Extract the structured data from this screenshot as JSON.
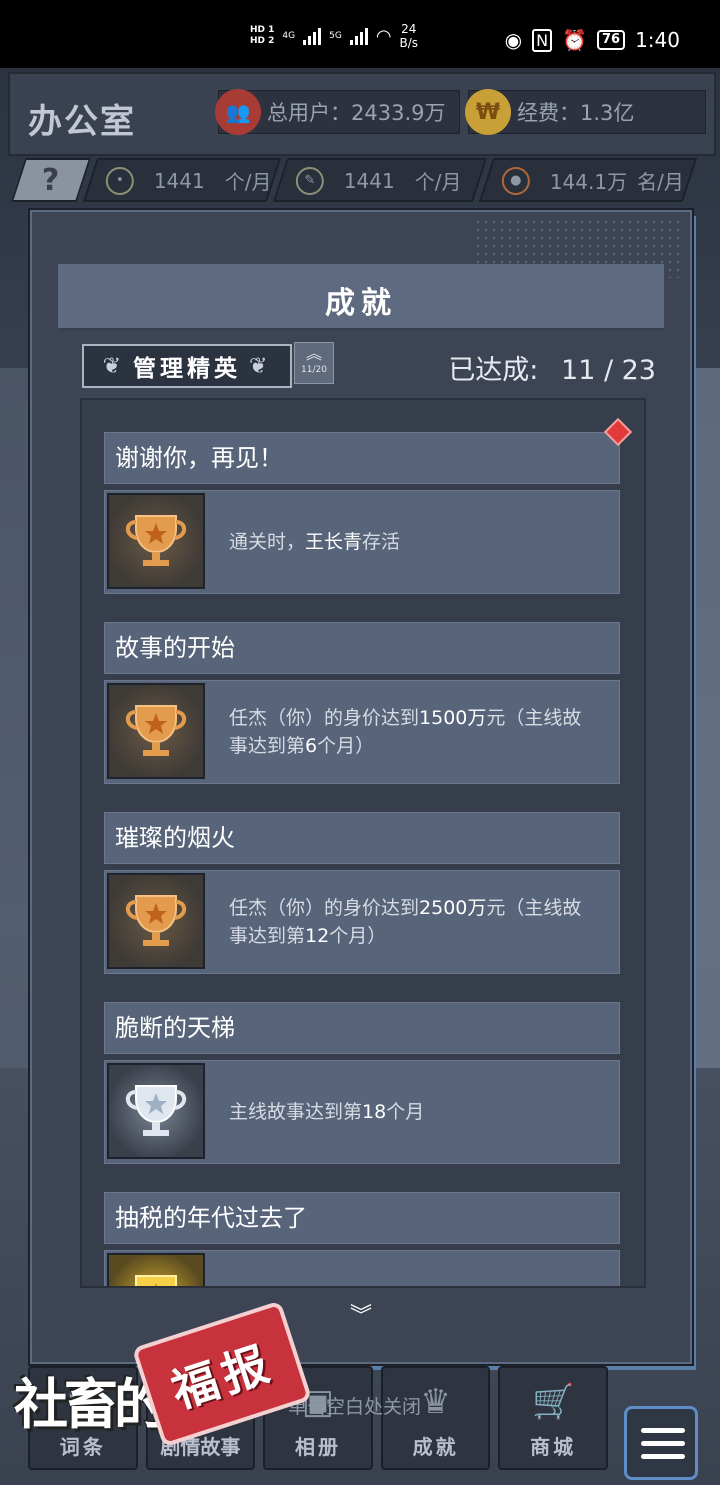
{
  "status_bar": {
    "hd1": "HD 1",
    "hd2": "HD 2",
    "net1": "4G",
    "net2": "5G",
    "speed_value": "24",
    "speed_unit": "B/s",
    "battery": "76",
    "time": "1:40"
  },
  "hud": {
    "office_title": "办公室",
    "users_label": "总用户：2433.9万",
    "fund_label": "经费：1.3亿",
    "help": "?",
    "stat1_value": "1441",
    "stat1_unit": "个/月",
    "stat2_value": "1441",
    "stat2_unit": "个/月",
    "stat3_value": "144.1万",
    "stat3_unit": "名/月"
  },
  "dialog": {
    "title": "成就",
    "rank": "管理精英",
    "rank_progress": "11/20",
    "achieved_label": "已达成:",
    "achieved_value": "11 / 23"
  },
  "achievements": [
    {
      "title": "谢谢你，再见！",
      "desc_pre": "通关时，",
      "desc_highlight": "王长青",
      "desc_post": "存活",
      "trophy": "bronze",
      "new": true
    },
    {
      "title": "故事的开始",
      "desc_pre": "任杰（你）的身价达到",
      "desc_highlight": "1500万",
      "desc_post": "元（主线故事达到第",
      "desc_highlight2": "6",
      "desc_post2": "个月）",
      "trophy": "bronze",
      "new": false
    },
    {
      "title": "璀璨的烟火",
      "desc_pre": "任杰（你）的身价达到",
      "desc_highlight": "2500万",
      "desc_post": "元（主线故事达到第",
      "desc_highlight2": "12",
      "desc_post2": "个月）",
      "trophy": "bronze",
      "new": false
    },
    {
      "title": "脆断的天梯",
      "desc_pre": "主线故事达到第",
      "desc_highlight": "18",
      "desc_post": "个月",
      "trophy": "silver",
      "new": false
    },
    {
      "title": "抽税的年代过去了",
      "trophy": "gold",
      "new": false
    }
  ],
  "bottom_nav": {
    "items": [
      {
        "label": "词条",
        "icon": "book-icon"
      },
      {
        "label": "剧情故事",
        "icon": "story-icon"
      },
      {
        "label": "相册",
        "icon": "album-icon"
      },
      {
        "label": "成就",
        "icon": "trophy-icon"
      },
      {
        "label": "商城",
        "icon": "cart-icon"
      }
    ],
    "close_hint": "单击空白处关闭"
  },
  "logo": {
    "text": "社畜的",
    "stamp": "福报"
  }
}
